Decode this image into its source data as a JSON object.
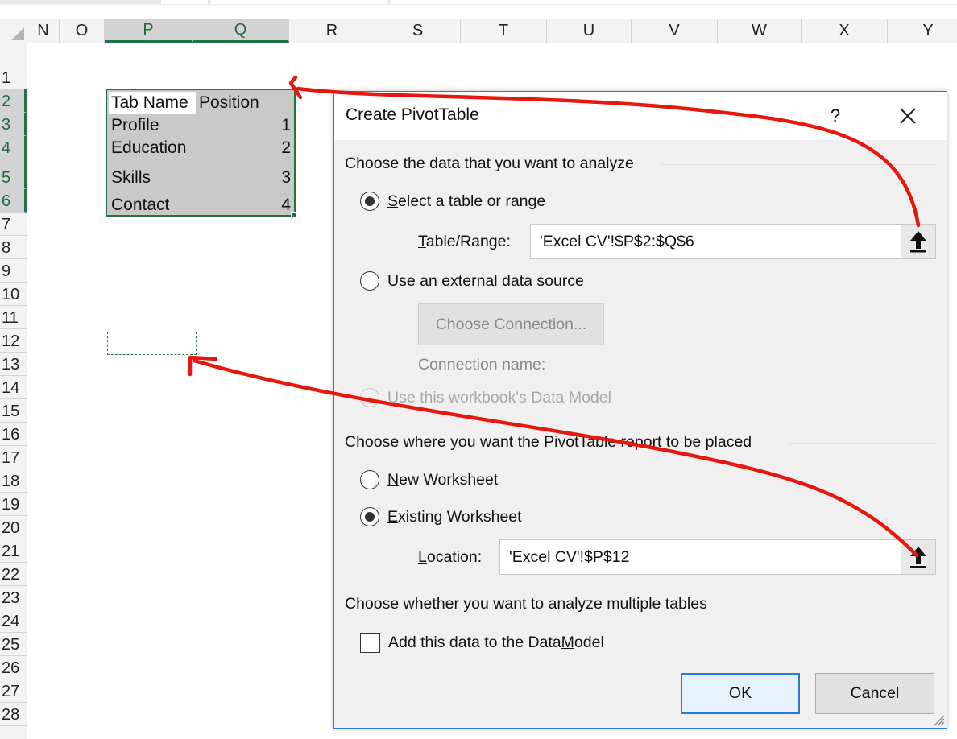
{
  "sheet": {
    "columns": [
      "N",
      "O",
      "P",
      "Q",
      "R",
      "S",
      "T",
      "U",
      "V",
      "W",
      "X",
      "Y"
    ],
    "selected_columns": [
      "P",
      "Q"
    ],
    "rows": [
      "1",
      "2",
      "3",
      "4",
      "5",
      "6",
      "7",
      "8",
      "9",
      "10",
      "11",
      "12",
      "13",
      "14",
      "15",
      "16",
      "17",
      "18",
      "19",
      "20",
      "21",
      "22",
      "23",
      "24",
      "25",
      "26",
      "27",
      "28"
    ],
    "selected_rows": [
      "2",
      "3",
      "4",
      "5",
      "6"
    ],
    "table": {
      "headers": [
        "Tab Name",
        "Position"
      ],
      "rows": [
        [
          "Profile",
          "1"
        ],
        [
          "Education",
          "2"
        ],
        [
          "Skills",
          "3"
        ],
        [
          "Contact",
          "4"
        ]
      ]
    }
  },
  "dialog": {
    "title": "Create PivotTable",
    "help": "?",
    "section1": "Choose the data that you want to analyze",
    "opt_select_table": {
      "first": "S",
      "rest": "elect a table or range",
      "checked": true
    },
    "table_range": {
      "label_first": "T",
      "label_rest": "able/Range:",
      "value": "'Excel CV'!$P$2:$Q$6"
    },
    "opt_external": {
      "first": "U",
      "rest": "se an external data source",
      "checked": false
    },
    "choose_connection": "Choose Connection...",
    "connection_name": "Connection name:",
    "opt_data_model": {
      "first": "U",
      "rest": "se this workbook's Data Model",
      "checked": false
    },
    "section2": "Choose where you want the PivotTable report to be placed",
    "opt_new_ws": {
      "first": "N",
      "rest": "ew Worksheet",
      "checked": false
    },
    "opt_existing_ws": {
      "first": "E",
      "rest": "xisting Worksheet",
      "checked": true
    },
    "location": {
      "label_first": "L",
      "label_rest": "ocation:",
      "value": "'Excel CV'!$P$12"
    },
    "section3": "Choose whether you want to analyze multiple tables",
    "add_data_model": {
      "before": "Add this data to the Data ",
      "ul": "M",
      "after": "odel",
      "checked": false
    },
    "ok": "OK",
    "cancel": "Cancel"
  },
  "colors": {
    "excel_green": "#217346",
    "annotation_red": "#e8170e",
    "dialog_accent": "#2b79d7"
  },
  "icons": [
    "close-icon",
    "collapse-arrow-icon",
    "resize-grip-icon"
  ]
}
